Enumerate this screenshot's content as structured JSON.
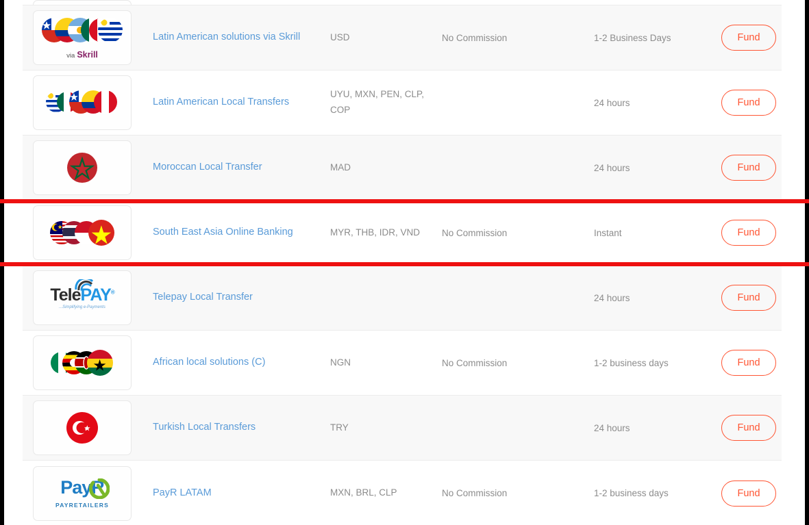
{
  "theme": {
    "link_color": "#5a9bd8",
    "muted_text_color": "#8c8c8c",
    "accent_color": "#ff5533",
    "highlight_color": "#ee1111",
    "alt_row_bg": "#f8f8f8",
    "row_bg": "#ffffff"
  },
  "table": {
    "action_label": "Fund",
    "rows": [
      {
        "logo": "partial-row-logo",
        "name": "",
        "currencies": "",
        "commission": "",
        "time": "",
        "partial": true,
        "alt": false
      },
      {
        "logo": "latam-flags-skrill-logo",
        "logo_text_via": "via",
        "logo_text_brand": "Skrill",
        "name": "Latin American solutions via Skrill",
        "currencies": "USD",
        "commission": "No Commission",
        "time": "1-2 Business Days",
        "action": "Fund",
        "alt": true,
        "highlighted": false
      },
      {
        "logo": "latam-local-flags-logo",
        "name": "Latin American Local Transfers",
        "currencies": "UYU, MXN, PEN, CLP, COP",
        "commission": "",
        "time": "24 hours",
        "action": "Fund",
        "alt": false,
        "highlighted": false
      },
      {
        "logo": "morocco-flag-logo",
        "name": "Moroccan Local Transfer",
        "currencies": "MAD",
        "commission": "",
        "time": "24 hours",
        "action": "Fund",
        "alt": true,
        "highlighted": false
      },
      {
        "logo": "sea-flags-logo",
        "name": "South East Asia Online Banking",
        "currencies": "MYR, THB, IDR, VND",
        "commission": "No Commission",
        "time": "Instant",
        "action": "Fund",
        "alt": false,
        "highlighted": true
      },
      {
        "logo": "telepay-logo",
        "logo_text_part1": "Tele",
        "logo_text_part2": "PAY",
        "logo_tagline": "...Simplifying e-Payments",
        "name": "Telepay Local Transfer",
        "currencies": "",
        "commission": "",
        "time": "24 hours",
        "action": "Fund",
        "alt": true,
        "highlighted": false
      },
      {
        "logo": "africa-flags-logo",
        "name": "African local solutions (C)",
        "currencies": "NGN",
        "commission": "No Commission",
        "time": "1-2 business days",
        "action": "Fund",
        "alt": false,
        "highlighted": false
      },
      {
        "logo": "turkey-flag-logo",
        "name": "Turkish Local Transfers",
        "currencies": "TRY",
        "commission": "",
        "time": "24 hours",
        "action": "Fund",
        "alt": true,
        "highlighted": false
      },
      {
        "logo": "payretailers-logo",
        "logo_text_main": "PayR",
        "logo_text_sub": "PAYRETAILERS",
        "name": "PayR LATAM",
        "currencies": "MXN, BRL, CLP",
        "commission": "No Commission",
        "time": "1-2 business days",
        "action": "Fund",
        "alt": false,
        "highlighted": false
      }
    ]
  }
}
